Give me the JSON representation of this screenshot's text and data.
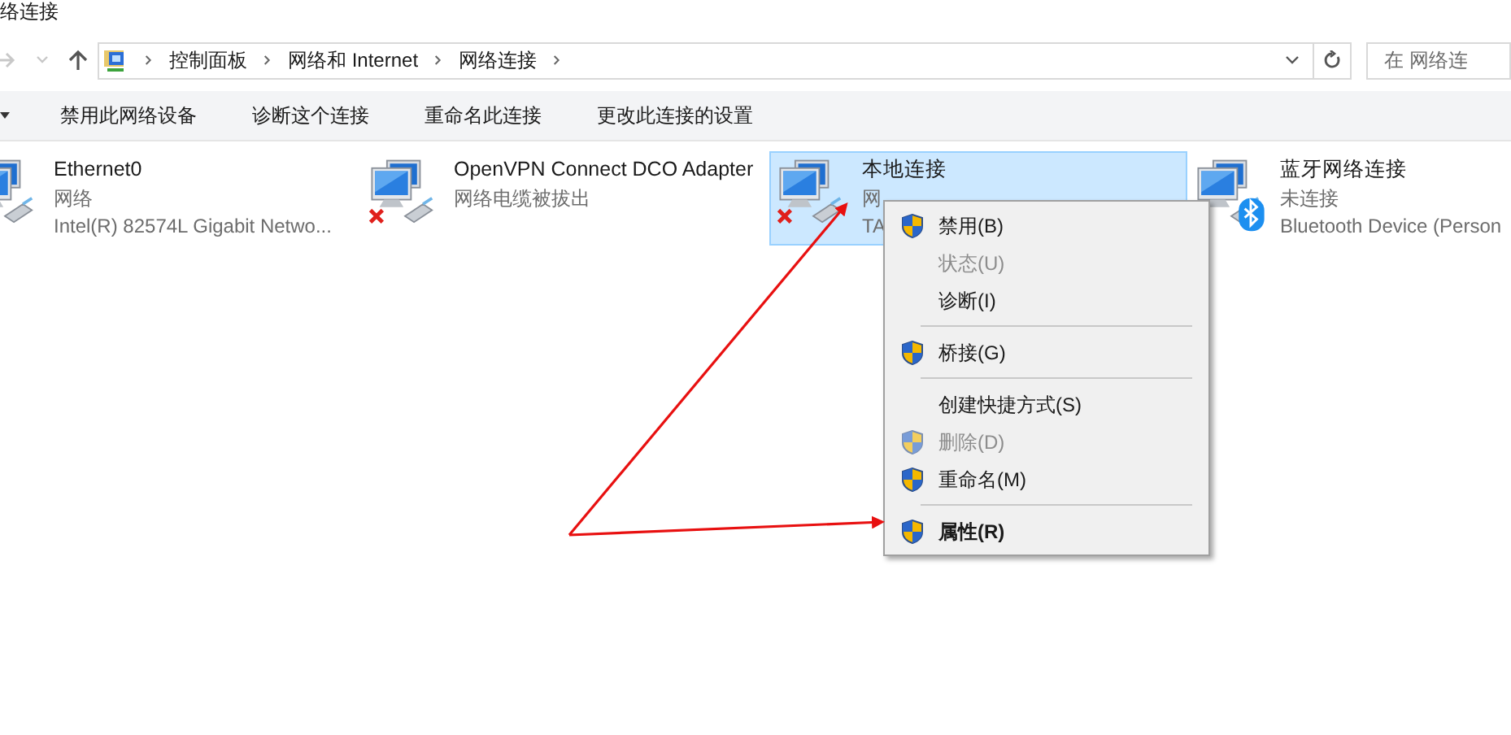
{
  "window": {
    "title": "络连接"
  },
  "address_bar": {
    "crumbs": [
      "控制面板",
      "网络和 Internet",
      "网络连接"
    ]
  },
  "search": {
    "placeholder": "在 网络连"
  },
  "toolbar": {
    "buttons": [
      "禁用此网络设备",
      "诊断这个连接",
      "重命名此连接",
      "更改此连接的设置"
    ]
  },
  "adapters": [
    {
      "name": "Ethernet0",
      "status": "网络",
      "device": "Intel(R) 82574L Gigabit Netwo...",
      "kind": "plain",
      "selected": false
    },
    {
      "name": "OpenVPN Connect DCO Adapter",
      "status": "网络电缆被拔出",
      "kind": "unplugged",
      "selected": false
    },
    {
      "name": "本地连接",
      "status": "网",
      "device": "TA",
      "kind": "unplugged",
      "selected": true
    },
    {
      "name": "蓝牙网络连接",
      "status": "未连接",
      "device": "Bluetooth Device (Person",
      "kind": "bluetooth",
      "selected": false
    }
  ],
  "context_menu": {
    "items": [
      {
        "kind": "item",
        "label": "禁用(B)",
        "shield": true,
        "disabled": false,
        "default": false
      },
      {
        "kind": "item",
        "label": "状态(U)",
        "shield": false,
        "disabled": true,
        "default": false
      },
      {
        "kind": "item",
        "label": "诊断(I)",
        "shield": false,
        "disabled": false,
        "default": false
      },
      {
        "kind": "separator"
      },
      {
        "kind": "item",
        "label": "桥接(G)",
        "shield": true,
        "disabled": false,
        "default": false
      },
      {
        "kind": "separator"
      },
      {
        "kind": "item",
        "label": "创建快捷方式(S)",
        "shield": false,
        "disabled": false,
        "default": false
      },
      {
        "kind": "item",
        "label": "删除(D)",
        "shield": true,
        "disabled": true,
        "default": false
      },
      {
        "kind": "item",
        "label": "重命名(M)",
        "shield": true,
        "disabled": false,
        "default": false
      },
      {
        "kind": "separator"
      },
      {
        "kind": "item",
        "label": "属性(R)",
        "shield": true,
        "disabled": false,
        "default": true
      }
    ]
  }
}
